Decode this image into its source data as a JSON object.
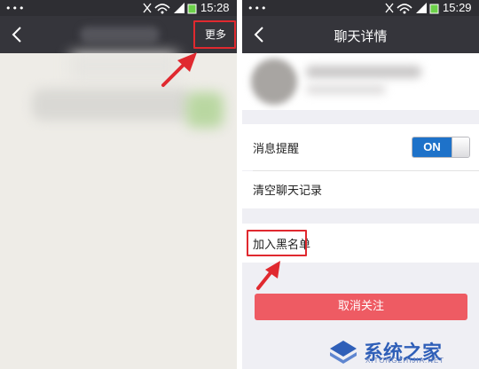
{
  "left": {
    "status": {
      "dots": "•••",
      "time": "15:28"
    },
    "nav": {
      "more_label": "更多"
    }
  },
  "right": {
    "status": {
      "dots": "•••",
      "time": "15:29"
    },
    "nav": {
      "title": "聊天详情"
    },
    "settings": {
      "notify_label": "消息提醒",
      "notify_toggle": "ON",
      "clear_label": "清空聊天记录",
      "blacklist_label": "加入黑名单",
      "unfollow_label": "取消关注"
    }
  },
  "watermark": {
    "text": "系统之家",
    "url": "XITONGZHIJIA.NET"
  },
  "colors": {
    "accent_red": "#e0292f",
    "toggle_blue": "#1e72c9",
    "unfollow_red": "#ee5b63",
    "navbar": "#35353b"
  }
}
